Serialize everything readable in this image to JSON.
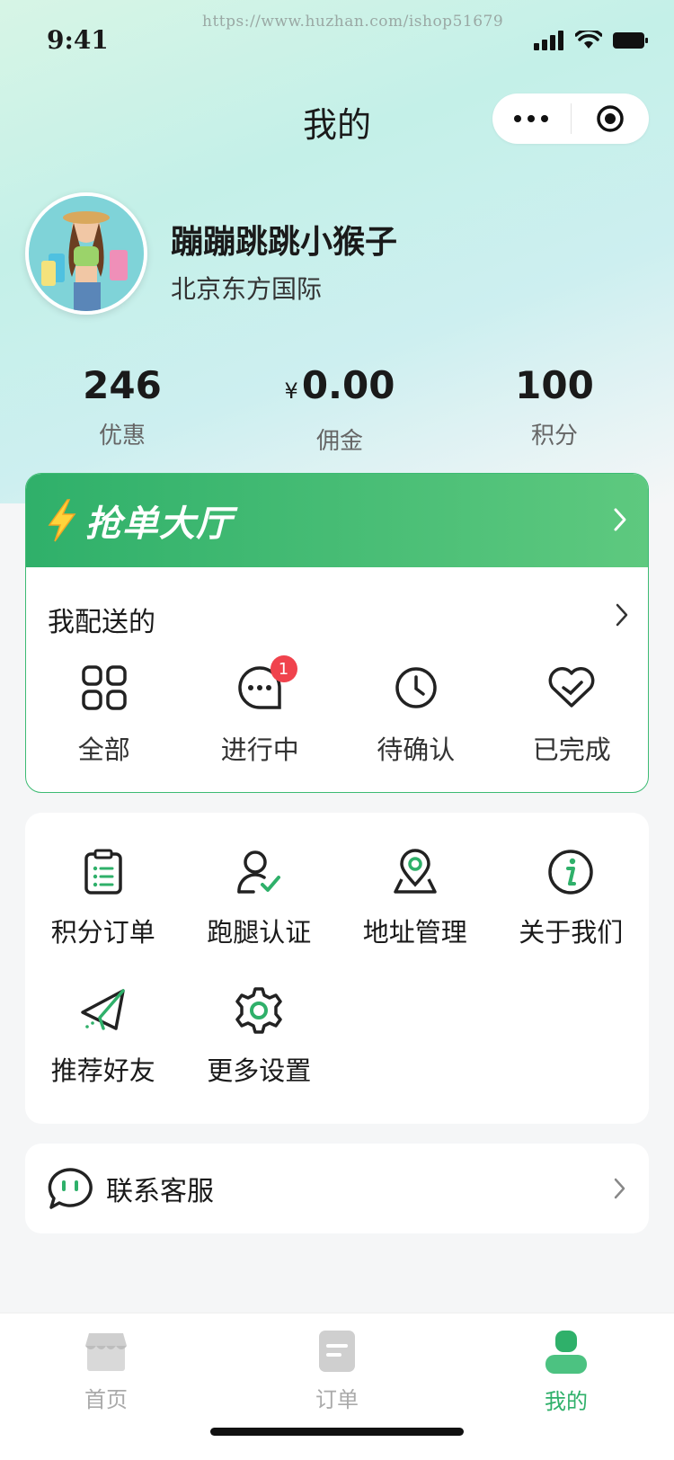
{
  "status_bar": {
    "time": "9:41",
    "watermark": "https://www.huzhan.com/ishop51679"
  },
  "header": {
    "title": "我的"
  },
  "profile": {
    "name": "蹦蹦跳跳小猴子",
    "company": "北京东方国际"
  },
  "stats": [
    {
      "value": "246",
      "label": "优惠"
    },
    {
      "currency": "¥",
      "value": "0.00",
      "label": "佣金"
    },
    {
      "value": "100",
      "label": "积分"
    }
  ],
  "grab_hall": {
    "title": "抢单大厅"
  },
  "delivery": {
    "title": "我配送的",
    "items": [
      {
        "label": "全部",
        "icon": "grid-icon"
      },
      {
        "label": "进行中",
        "icon": "chat-dots-icon",
        "badge": "1"
      },
      {
        "label": "待确认",
        "icon": "clock-icon"
      },
      {
        "label": "已完成",
        "icon": "heart-check-icon"
      }
    ]
  },
  "services": {
    "items": [
      {
        "label": "积分订单",
        "icon": "clipboard-icon"
      },
      {
        "label": "跑腿认证",
        "icon": "user-check-icon"
      },
      {
        "label": "地址管理",
        "icon": "location-pin-icon"
      },
      {
        "label": "关于我们",
        "icon": "info-icon"
      },
      {
        "label": "推荐好友",
        "icon": "paper-plane-icon"
      },
      {
        "label": "更多设置",
        "icon": "gear-icon"
      }
    ]
  },
  "customer_service": {
    "label": "联系客服"
  },
  "tabbar": {
    "tabs": [
      {
        "label": "首页",
        "icon": "shop-icon",
        "active": false
      },
      {
        "label": "订单",
        "icon": "order-doc-icon",
        "active": false
      },
      {
        "label": "我的",
        "icon": "user-icon",
        "active": true
      }
    ]
  },
  "colors": {
    "accent": "#2fb06a",
    "badge": "#f0434d",
    "text": "#1a1a1a"
  }
}
